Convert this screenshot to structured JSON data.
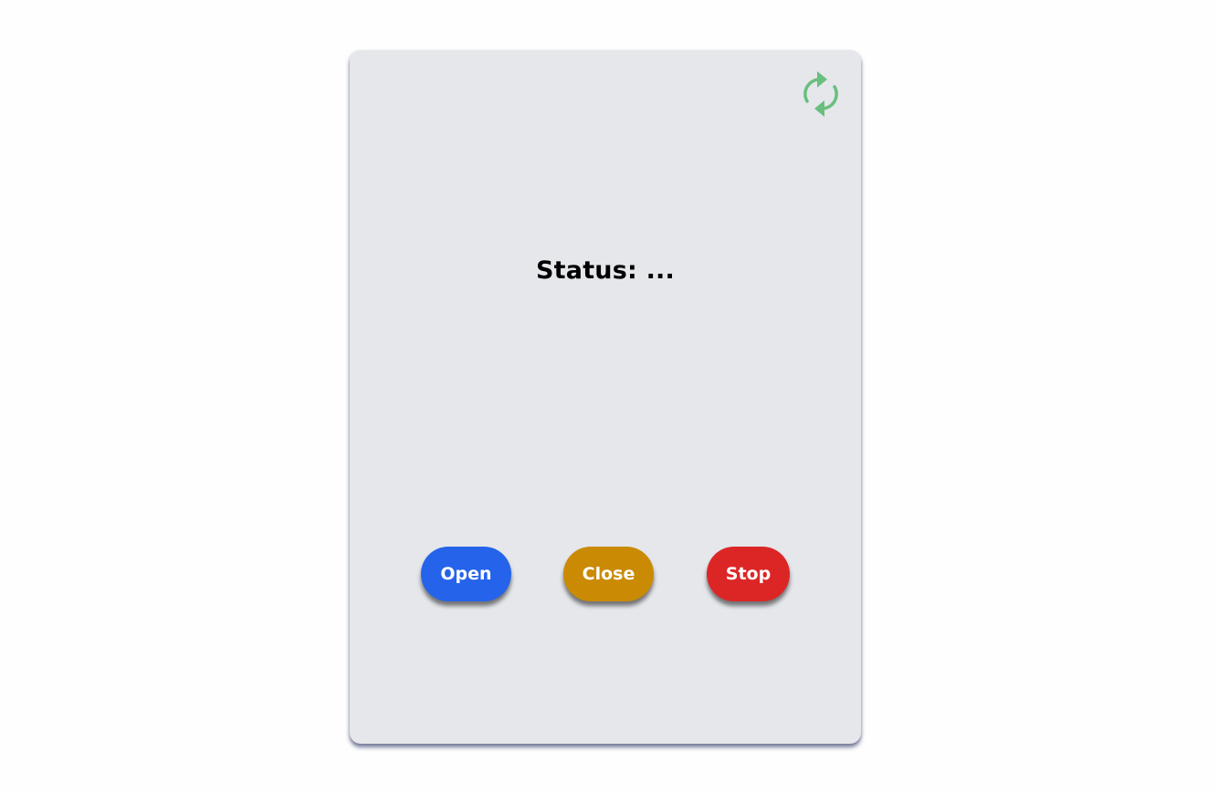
{
  "status": {
    "text": "Status: ..."
  },
  "controls": {
    "open_label": "Open",
    "close_label": "Close",
    "stop_label": "Stop"
  },
  "icons": {
    "refresh": "refresh-icon"
  },
  "colors": {
    "open": "#2563eb",
    "close": "#ca8a04",
    "stop": "#dc2626",
    "refresh": "#6abf7e",
    "card": "#e5e7eb"
  }
}
